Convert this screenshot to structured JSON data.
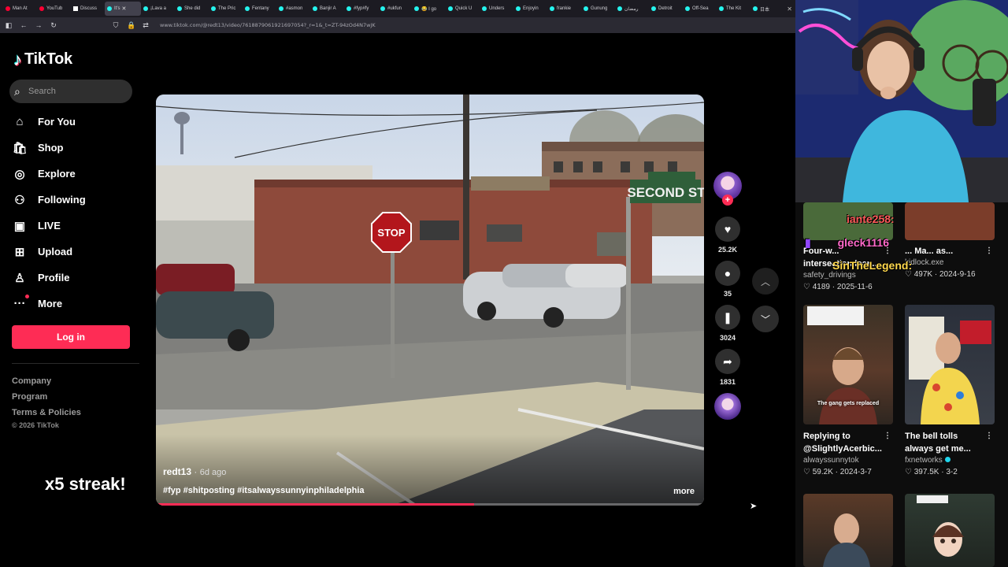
{
  "browser": {
    "tabs": [
      {
        "label": "Man At",
        "icon": "youtube"
      },
      {
        "label": "YouTub",
        "icon": "youtube"
      },
      {
        "label": "Discuss",
        "icon": "x"
      },
      {
        "label": "It's",
        "icon": "tiktok",
        "active": true
      },
      {
        "label": "¡Lava a",
        "icon": "tiktok"
      },
      {
        "label": "She did",
        "icon": "tiktok"
      },
      {
        "label": "The Pric",
        "icon": "tiktok"
      },
      {
        "label": "Fentany",
        "icon": "tiktok"
      },
      {
        "label": "#asmon",
        "icon": "tiktok"
      },
      {
        "label": "Banjir A",
        "icon": "tiktok"
      },
      {
        "label": "#fyp#fy",
        "icon": "tiktok"
      },
      {
        "label": "#ukfun",
        "icon": "tiktok"
      },
      {
        "label": "😂 I go",
        "icon": "tiktok"
      },
      {
        "label": "Quick U",
        "icon": "tiktok"
      },
      {
        "label": "Unders",
        "icon": "tiktok"
      },
      {
        "label": "Enjoyin",
        "icon": "tiktok"
      },
      {
        "label": "frankie",
        "icon": "tiktok"
      },
      {
        "label": "Gunung",
        "icon": "tiktok"
      },
      {
        "label": "رمضان",
        "icon": "tiktok"
      },
      {
        "label": "Detroit",
        "icon": "tiktok"
      },
      {
        "label": "Off-Sea",
        "icon": "tiktok"
      },
      {
        "label": "The Kit",
        "icon": "tiktok"
      },
      {
        "label": "日本",
        "icon": "tiktok"
      }
    ],
    "url": "www.tiktok.com/@redt13/video/7618879061921697054?_r=1&_t=ZT-94zOd4N7wJK"
  },
  "sidebar": {
    "logo_text": "TikTok",
    "search_placeholder": "Search",
    "nav": [
      {
        "label": "For You",
        "icon": "home-icon",
        "glyph": "⌂"
      },
      {
        "label": "Shop",
        "icon": "shopping-bag-icon",
        "glyph": "🛍"
      },
      {
        "label": "Explore",
        "icon": "compass-icon",
        "glyph": "◎"
      },
      {
        "label": "Following",
        "icon": "following-icon",
        "glyph": "⚇"
      },
      {
        "label": "LIVE",
        "icon": "live-icon",
        "glyph": "▣"
      },
      {
        "label": "Upload",
        "icon": "upload-icon",
        "glyph": "⊞"
      },
      {
        "label": "Profile",
        "icon": "profile-icon",
        "glyph": "♙"
      },
      {
        "label": "More",
        "icon": "more-icon",
        "glyph": "···"
      }
    ],
    "login_label": "Log in",
    "footer": [
      "Company",
      "Program",
      "Terms & Policies"
    ],
    "copyright": "© 2026 TikTok"
  },
  "overlay": {
    "streak": "x5 streak!"
  },
  "video": {
    "author": "redt13",
    "age": "6d ago",
    "hashtags": "#fyp #shitposting #itsalwayssunnyinphiladelphia",
    "more_label": "more",
    "progress": 0.58,
    "sign_street": "SECOND ST",
    "sign_stop": "STOP"
  },
  "actions": {
    "likes": "25.2K",
    "comments": "35",
    "saves": "3024",
    "shares": "1831"
  },
  "chat": [
    {
      "user": "iante258:",
      "color": "#ff5a5a"
    },
    {
      "user": "gleck1116",
      "color": "#ff69c9"
    },
    {
      "user": "SinTheLegend:",
      "color": "#ffd84d"
    }
  ],
  "recommended": [
    {
      "title": "Four-w... intersection lear...",
      "author": "safety_drivings",
      "likes": "4189",
      "date": "2025-11-6",
      "verified": false
    },
    {
      "title": "... Ma... as...",
      "author": "kidlock.exe",
      "likes": "497K",
      "date": "2024-9-16",
      "verified": false
    },
    {
      "title": "Replying to @SlightlyAcerbic...",
      "author": "alwayssunnytok",
      "likes": "59.2K",
      "date": "2024-3-7",
      "verified": false,
      "caption": "The gang gets replaced"
    },
    {
      "title": "The bell tolls always get me...",
      "author": "fxnetworks",
      "likes": "397.5K",
      "date": "3-2",
      "verified": true
    }
  ],
  "colors": {
    "brand": "#fe2c55",
    "cyan": "#25f4ee"
  }
}
